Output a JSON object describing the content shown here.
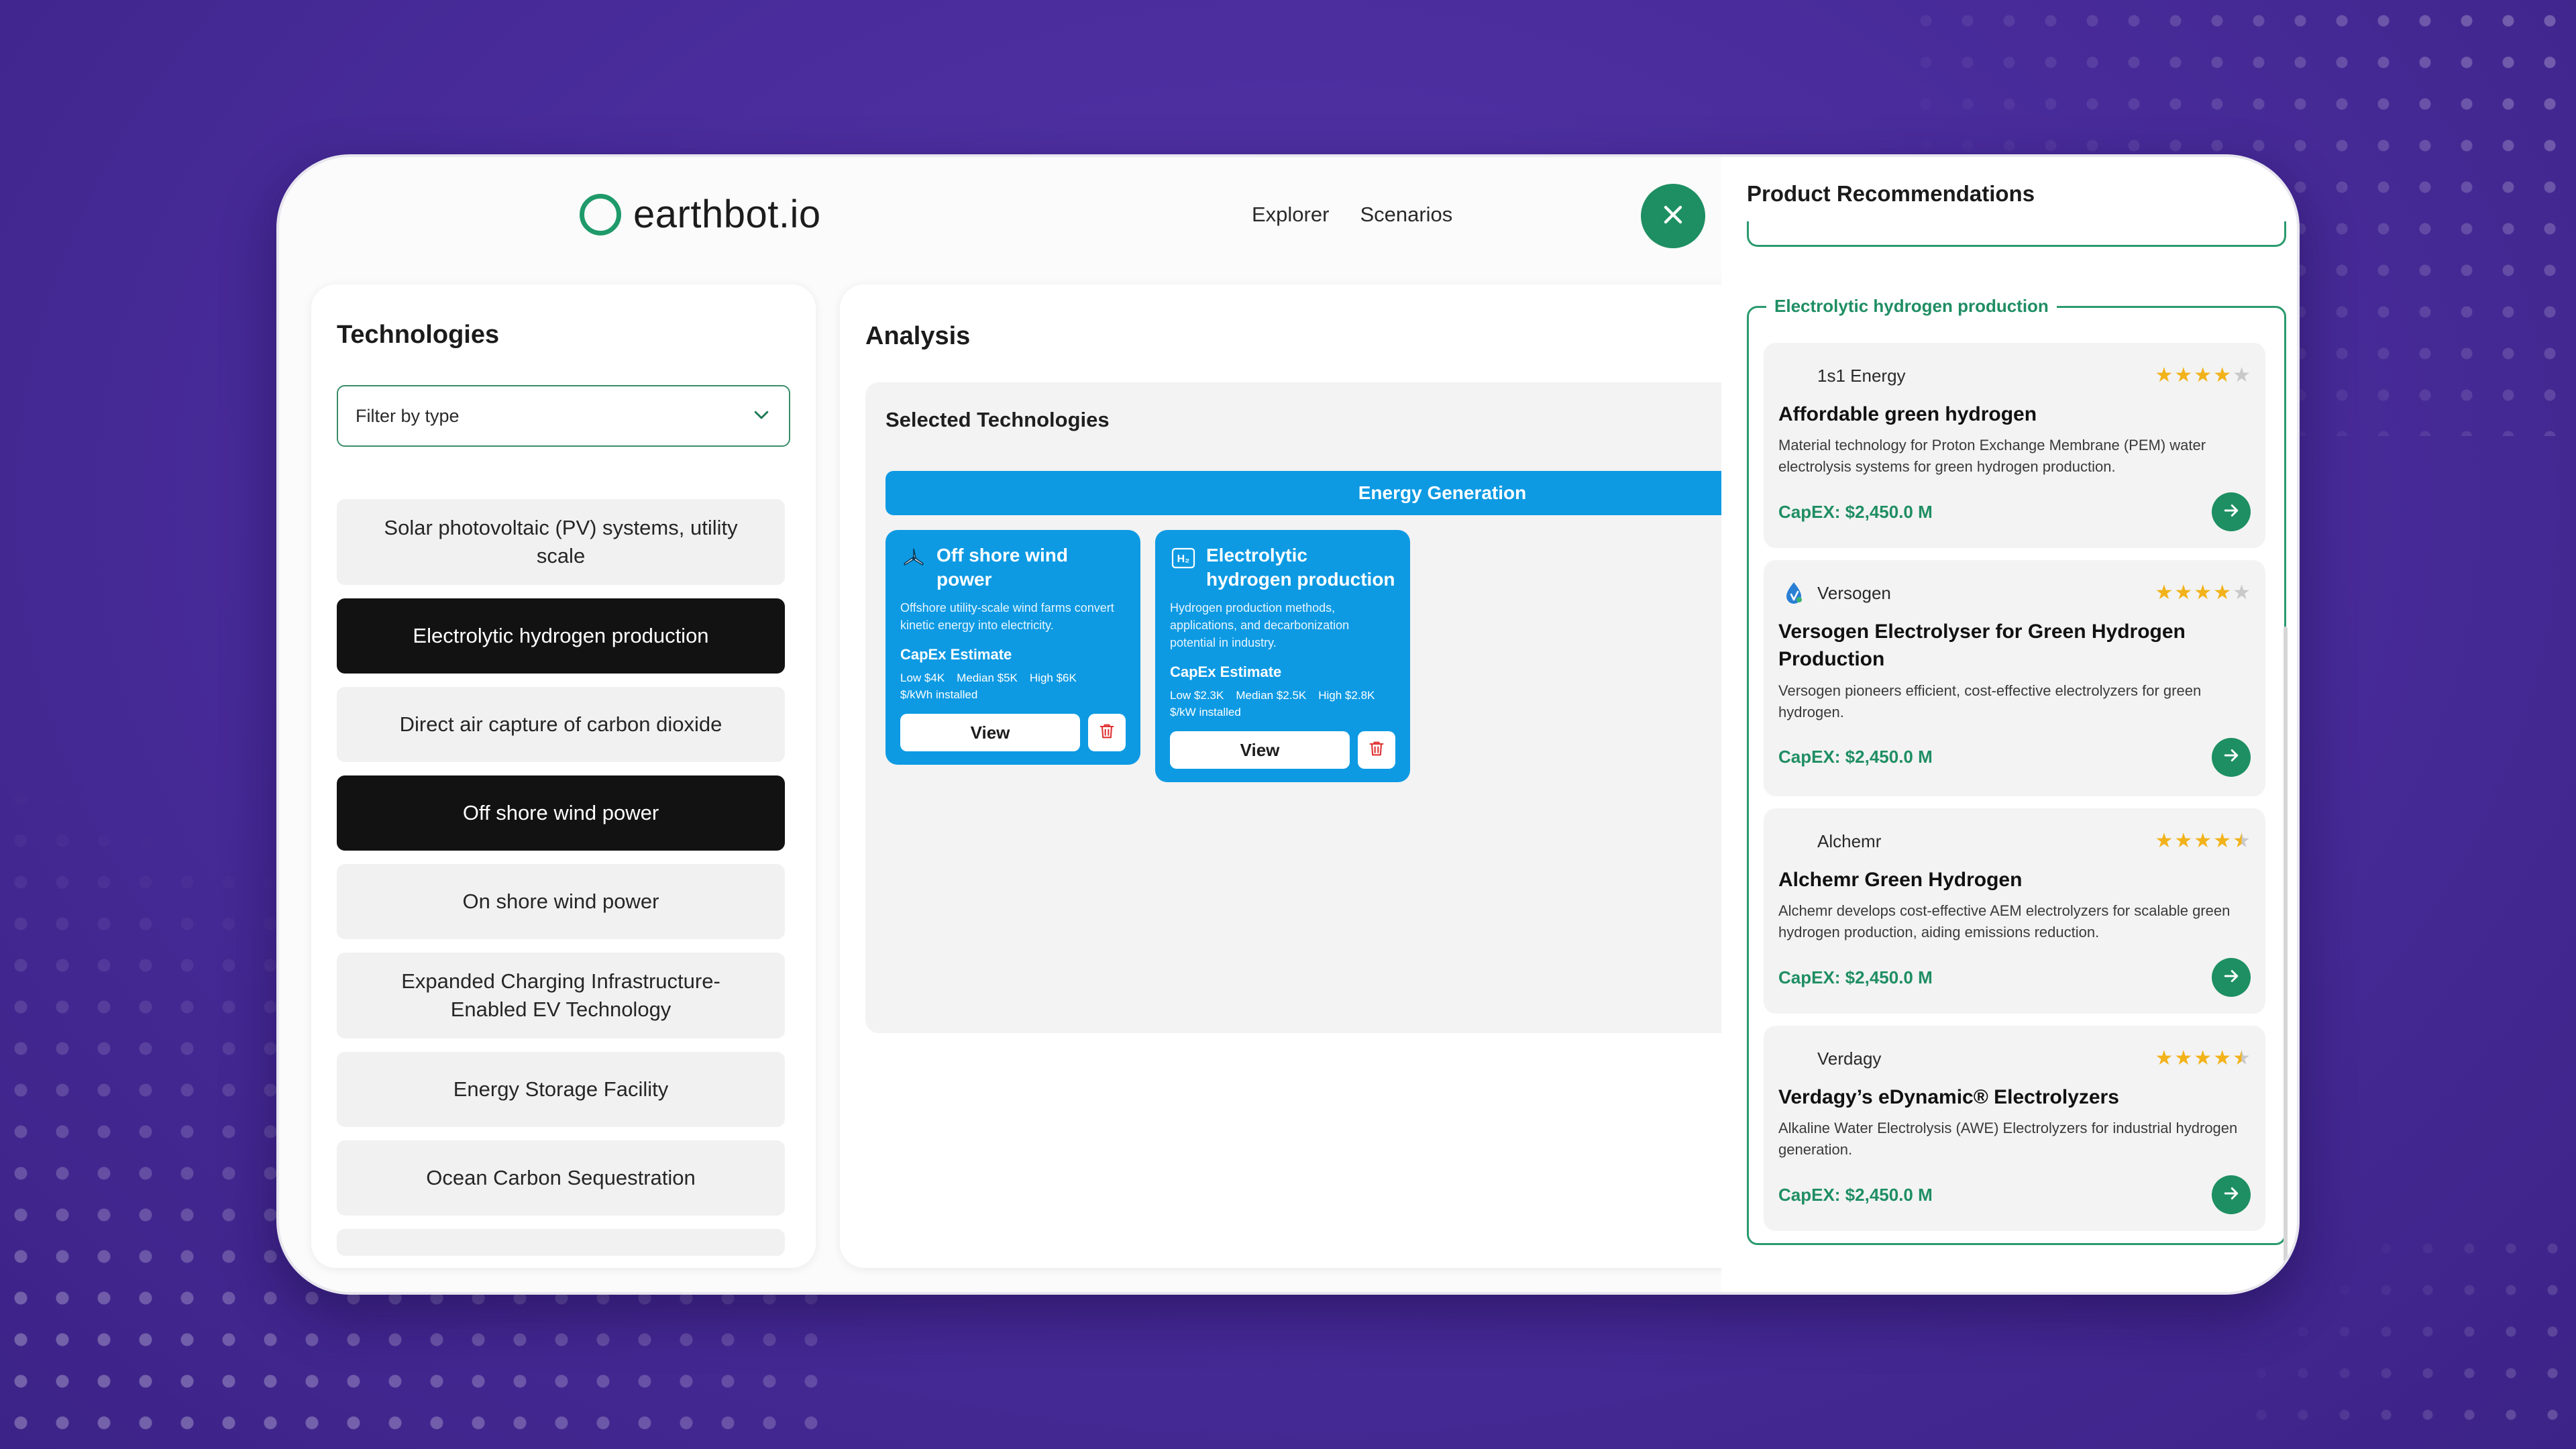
{
  "brand": {
    "name": "earthbot.io",
    "accent": "#1f9a6a"
  },
  "nav": {
    "explorer": "Explorer",
    "scenarios": "Scenarios"
  },
  "technologies": {
    "title": "Technologies",
    "filter_placeholder": "Filter by type",
    "items": [
      {
        "label": "Solar photovoltaic (PV) systems, utility scale",
        "selected": false
      },
      {
        "label": "Electrolytic hydrogen production",
        "selected": true
      },
      {
        "label": "Direct air capture of carbon dioxide",
        "selected": false
      },
      {
        "label": "Off shore wind power",
        "selected": true
      },
      {
        "label": "On shore wind power",
        "selected": false
      },
      {
        "label": "Expanded Charging Infrastructure-Enabled EV Technology",
        "selected": false
      },
      {
        "label": "Energy Storage Facility",
        "selected": false
      },
      {
        "label": "Ocean Carbon Sequestration",
        "selected": false
      }
    ]
  },
  "analysis": {
    "title": "Analysis",
    "selected_title": "Selected Technologies",
    "category": "Energy Generation",
    "category_color": "#0d9ae3",
    "cards": [
      {
        "icon": "wind-turbine-icon",
        "title": "Off shore wind power",
        "description": "Offshore utility-scale wind farms convert kinetic energy into electricity.",
        "capex_label": "CapEx Estimate",
        "low": "Low $4K",
        "median": "Median $5K",
        "high": "High $6K",
        "unit": "$/kWh installed",
        "view_label": "View"
      },
      {
        "icon": "hydrogen-icon",
        "title": "Electrolytic hydrogen production",
        "description": "Hydrogen production methods, applications, and decarbonization potential in industry.",
        "capex_label": "CapEx Estimate",
        "low": "Low $2.3K",
        "median": "Median $2.5K",
        "high": "High $2.8K",
        "unit": "$/kW installed",
        "view_label": "View"
      }
    ]
  },
  "recommendations": {
    "title": "Product Recommendations",
    "group_label": "Electrolytic hydrogen production",
    "products": [
      {
        "vendor": "1s1 Energy",
        "rating": 4,
        "title": "Affordable green hydrogen",
        "description": "Material technology for Proton Exchange Membrane (PEM) water electrolysis systems for green hydrogen production.",
        "capex": "CapEX: $2,450.0 M"
      },
      {
        "vendor": "Versogen",
        "rating": 4,
        "title": "Versogen Electrolyser for Green Hydrogen Production",
        "description": "Versogen pioneers efficient, cost-effective electrolyzers for green hydrogen.",
        "capex": "CapEX: $2,450.0 M"
      },
      {
        "vendor": "Alchemr",
        "rating": 4.5,
        "title": "Alchemr Green Hydrogen",
        "description": "Alchemr develops cost-effective AEM electrolyzers for scalable green hydrogen production, aiding emissions reduction.",
        "capex": "CapEX: $2,450.0 M"
      },
      {
        "vendor": "Verdagy",
        "rating": 4.5,
        "title": "Verdagy’s eDynamic® Electrolyzers",
        "description": "Alkaline Water Electrolysis (AWE) Electrolyzers for industrial hydrogen generation.",
        "capex": "CapEX: $2,450.0 M"
      }
    ]
  }
}
